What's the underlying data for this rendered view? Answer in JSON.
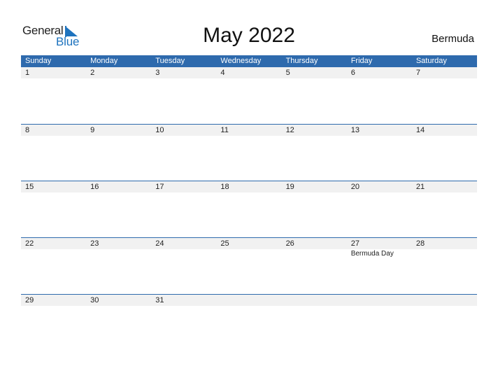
{
  "logo": {
    "line1": "General",
    "line2": "Blue"
  },
  "title": "May 2022",
  "country": "Bermuda",
  "weekdays": [
    "Sunday",
    "Monday",
    "Tuesday",
    "Wednesday",
    "Thursday",
    "Friday",
    "Saturday"
  ],
  "weeks": [
    {
      "days": [
        "1",
        "2",
        "3",
        "4",
        "5",
        "6",
        "7"
      ],
      "events": [
        "",
        "",
        "",
        "",
        "",
        "",
        ""
      ]
    },
    {
      "days": [
        "8",
        "9",
        "10",
        "11",
        "12",
        "13",
        "14"
      ],
      "events": [
        "",
        "",
        "",
        "",
        "",
        "",
        ""
      ]
    },
    {
      "days": [
        "15",
        "16",
        "17",
        "18",
        "19",
        "20",
        "21"
      ],
      "events": [
        "",
        "",
        "",
        "",
        "",
        "",
        ""
      ]
    },
    {
      "days": [
        "22",
        "23",
        "24",
        "25",
        "26",
        "27",
        "28"
      ],
      "events": [
        "",
        "",
        "",
        "",
        "",
        "Bermuda Day",
        ""
      ]
    },
    {
      "days": [
        "29",
        "30",
        "31",
        "",
        "",
        "",
        ""
      ],
      "events": [
        "",
        "",
        "",
        "",
        "",
        "",
        ""
      ]
    }
  ],
  "colors": {
    "accent": "#2e6aad",
    "band": "#f1f1f1",
    "logo_blue": "#1e73be"
  }
}
